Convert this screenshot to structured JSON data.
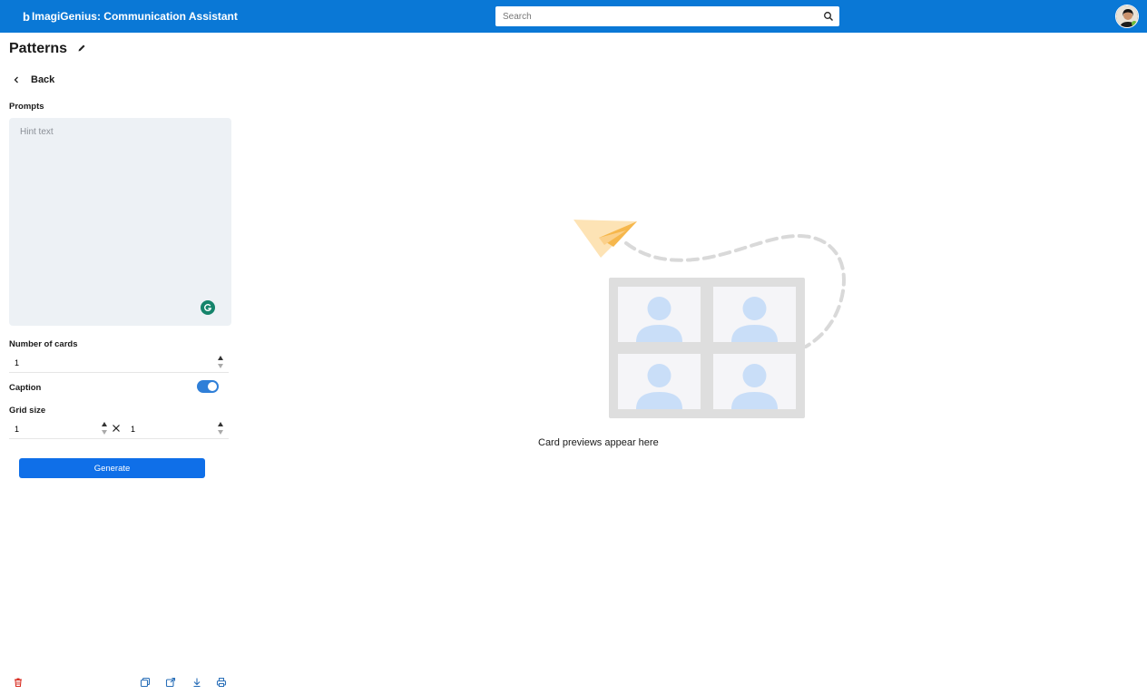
{
  "app": {
    "title": "ImagiGenius: Communication Assistant",
    "logo_glyph": "b",
    "brand_color": "#0a78d6"
  },
  "search": {
    "placeholder": "Search",
    "icon": "search-icon"
  },
  "user": {
    "avatar": "user-avatar"
  },
  "page": {
    "title": "Patterns",
    "edit_icon": "pencil-icon"
  },
  "nav": {
    "back_label": "Back"
  },
  "prompts": {
    "label": "Prompts",
    "placeholder": "Hint text",
    "assistant_icon": "grammarly-icon"
  },
  "number_of_cards": {
    "label": "Number of cards",
    "value": "1"
  },
  "caption": {
    "label": "Caption",
    "enabled": true
  },
  "grid_size": {
    "label": "Grid size",
    "rows": "1",
    "cols": "1",
    "separator_icon": "times-icon"
  },
  "actions": {
    "generate_label": "Generate",
    "accent": "#0f6fe8"
  },
  "preview": {
    "empty_message": "Card previews appear here"
  },
  "bottom_toolbar": {
    "icons": [
      "trash-icon",
      "copy-icon",
      "export-icon",
      "download-icon",
      "print-icon"
    ],
    "delete_color": "#d93025"
  }
}
